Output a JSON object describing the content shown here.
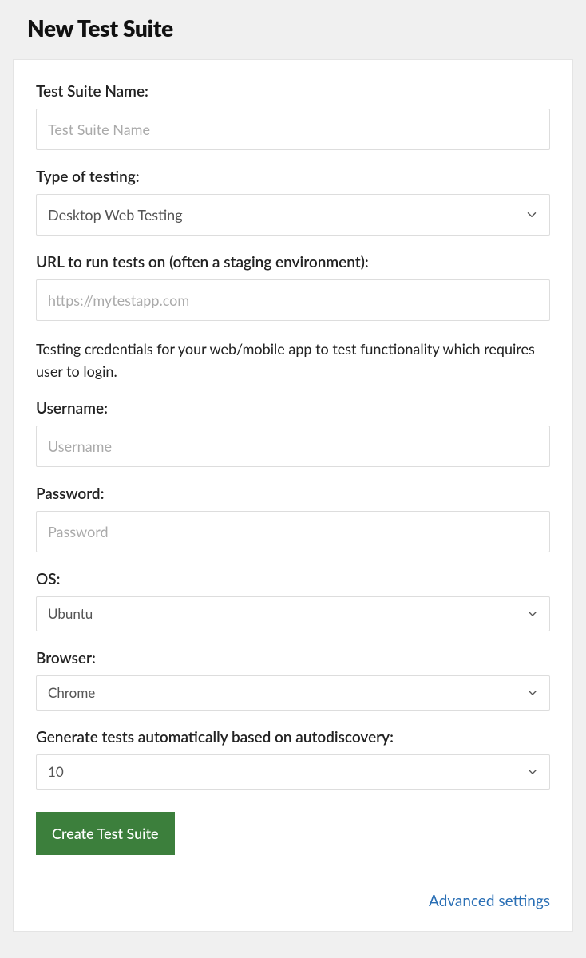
{
  "page": {
    "title": "New Test Suite"
  },
  "form": {
    "name": {
      "label": "Test Suite Name:",
      "placeholder": "Test Suite Name",
      "value": ""
    },
    "type": {
      "label": "Type of testing:",
      "selected": "Desktop Web Testing"
    },
    "url": {
      "label": "URL to run tests on (often a staging environment):",
      "placeholder": "https://mytestapp.com",
      "value": ""
    },
    "credentials_help": "Testing credentials for your web/mobile app to test functionality which requires user to login.",
    "username": {
      "label": "Username:",
      "placeholder": "Username",
      "value": ""
    },
    "password": {
      "label": "Password:",
      "placeholder": "Password",
      "value": ""
    },
    "os": {
      "label": "OS:",
      "selected": "Ubuntu"
    },
    "browser": {
      "label": "Browser:",
      "selected": "Chrome"
    },
    "autogen": {
      "label": "Generate tests automatically based on autodiscovery:",
      "selected": "10"
    },
    "submit_label": "Create Test Suite",
    "advanced_link": "Advanced settings"
  }
}
